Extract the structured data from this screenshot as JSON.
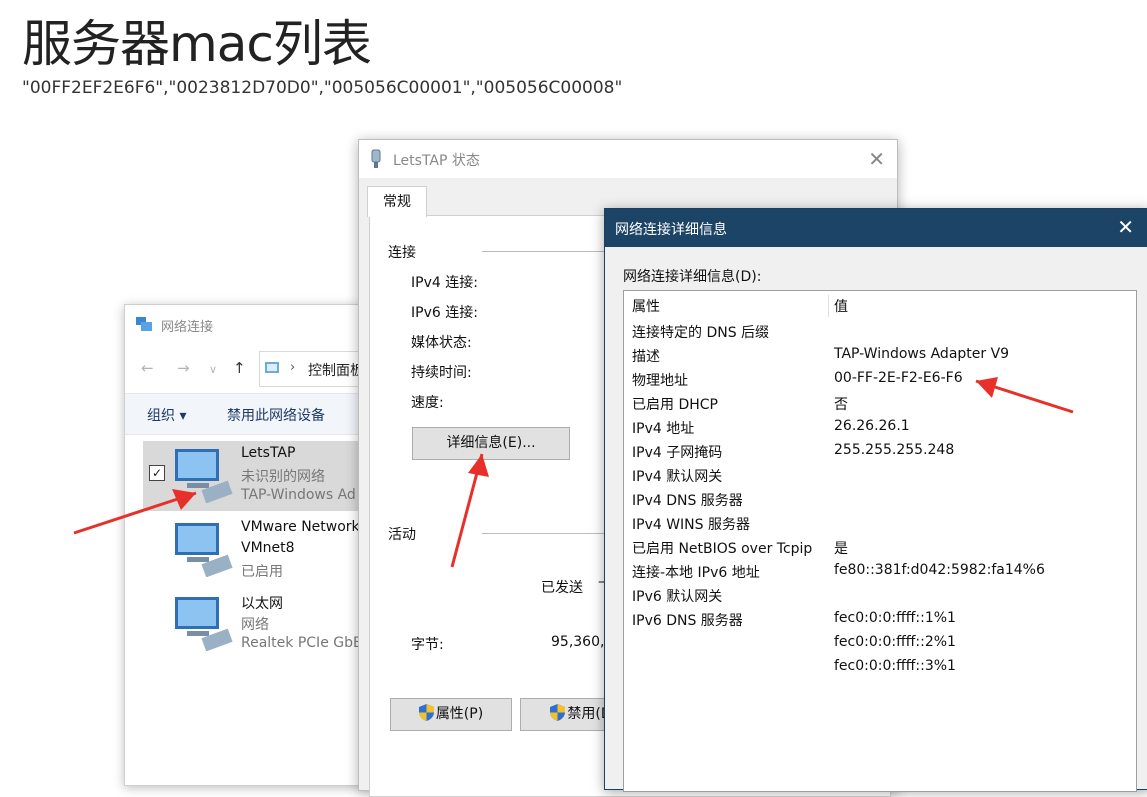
{
  "page": {
    "title": "服务器mac列表",
    "mac_list": "\"00FF2EF2E6F6\",\"0023812D70D0\",\"005056C00001\",\"005056C00008\""
  },
  "network_window": {
    "title": "网络连接",
    "address": "控制面板",
    "commands": {
      "organize": "组织 ▾",
      "disable": "禁用此网络设备"
    },
    "items": [
      {
        "name": "LetsTAP",
        "status": "未识别的网络",
        "adapter": "TAP-Windows Ad",
        "checked": true
      },
      {
        "name": "VMware Network",
        "status": "VMnet8",
        "adapter": "已启用"
      },
      {
        "name": "以太网",
        "status": "网络",
        "adapter": "Realtek PCIe GbE"
      }
    ]
  },
  "status_dialog": {
    "title": "LetsTAP 状态",
    "tab": "常规",
    "connection_group": "连接",
    "fields": [
      "IPv4 连接:",
      "IPv6 连接:",
      "媒体状态:",
      "持续时间:",
      "速度:"
    ],
    "details_button": "详细信息(E)...",
    "activity_group": "活动",
    "sent_label": "已发送",
    "bytes_label": "字节:",
    "bytes_value": "95,360,",
    "properties_button": "属性(P)",
    "disable_button": "禁用(D"
  },
  "details_dialog": {
    "title": "网络连接详细信息",
    "label": "网络连接详细信息(D):",
    "columns": {
      "property": "属性",
      "value": "值"
    },
    "rows": [
      {
        "property": "连接特定的 DNS 后缀",
        "value": ""
      },
      {
        "property": "描述",
        "value": "TAP-Windows Adapter V9"
      },
      {
        "property": "物理地址",
        "value": "00-FF-2E-F2-E6-F6"
      },
      {
        "property": "已启用 DHCP",
        "value": "否"
      },
      {
        "property": "IPv4 地址",
        "value": "26.26.26.1"
      },
      {
        "property": "IPv4 子网掩码",
        "value": "255.255.255.248"
      },
      {
        "property": "IPv4 默认网关",
        "value": ""
      },
      {
        "property": "IPv4 DNS 服务器",
        "value": ""
      },
      {
        "property": "IPv4 WINS 服务器",
        "value": ""
      },
      {
        "property": "已启用 NetBIOS over Tcpip",
        "value": "是"
      },
      {
        "property": "连接-本地 IPv6 地址",
        "value": "fe80::381f:d042:5982:fa14%6"
      },
      {
        "property": "IPv6 默认网关",
        "value": ""
      },
      {
        "property": "IPv6 DNS 服务器",
        "value": "fec0:0:0:ffff::1%1"
      },
      {
        "property": "",
        "value": "fec0:0:0:ffff::2%1"
      },
      {
        "property": "",
        "value": "fec0:0:0:ffff::3%1"
      }
    ]
  },
  "colors": {
    "details_titlebar": "#1c4466",
    "annotation_arrow": "#e8302a"
  }
}
